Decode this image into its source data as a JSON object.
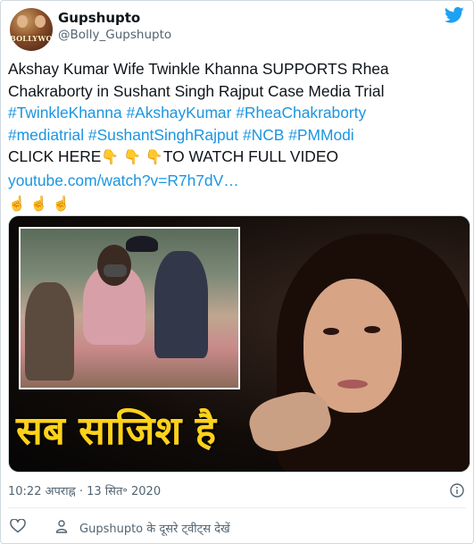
{
  "user": {
    "name": "Gupshupto",
    "handle": "@Bolly_Gupshupto",
    "avatar_text": "BOLLYWOOD"
  },
  "tweet": {
    "line1": "Akshay Kumar Wife Twinkle Khanna SUPPORTS Rhea",
    "line2": "Chakraborty in Sushant Singh Rajput Case Media Trial",
    "hashtags_line1": [
      "#TwinkleKhanna",
      "#AkshayKumar",
      "#RheaChakraborty"
    ],
    "hashtags_line2": [
      "#mediatrial",
      "#SushantSinghRajput",
      "#NCB",
      "#PMModi"
    ],
    "click_here": "CLICK HERE",
    "to_watch": "TO WATCH FULL VIDEO",
    "link": "youtube.com/watch?v=R7h7dV…",
    "point_down_emoji": "👇",
    "point_up_emoji": "☝"
  },
  "media": {
    "caption": "सब साजिश है"
  },
  "meta": {
    "time": "10:22 अपराह्न",
    "separator": "·",
    "date": "13 सित॰ 2020"
  },
  "footer": {
    "more_tweets": "Gupshupto के दूसरे ट्वीट्स देखें"
  },
  "icons": {
    "twitter": "twitter-bird-icon",
    "info": "info-icon",
    "like": "heart-icon",
    "profile": "person-icon"
  },
  "colors": {
    "link": "#1b95e0",
    "twitter_blue": "#1da1f2",
    "secondary_text": "#536471",
    "caption_yellow": "#ffd21a"
  }
}
